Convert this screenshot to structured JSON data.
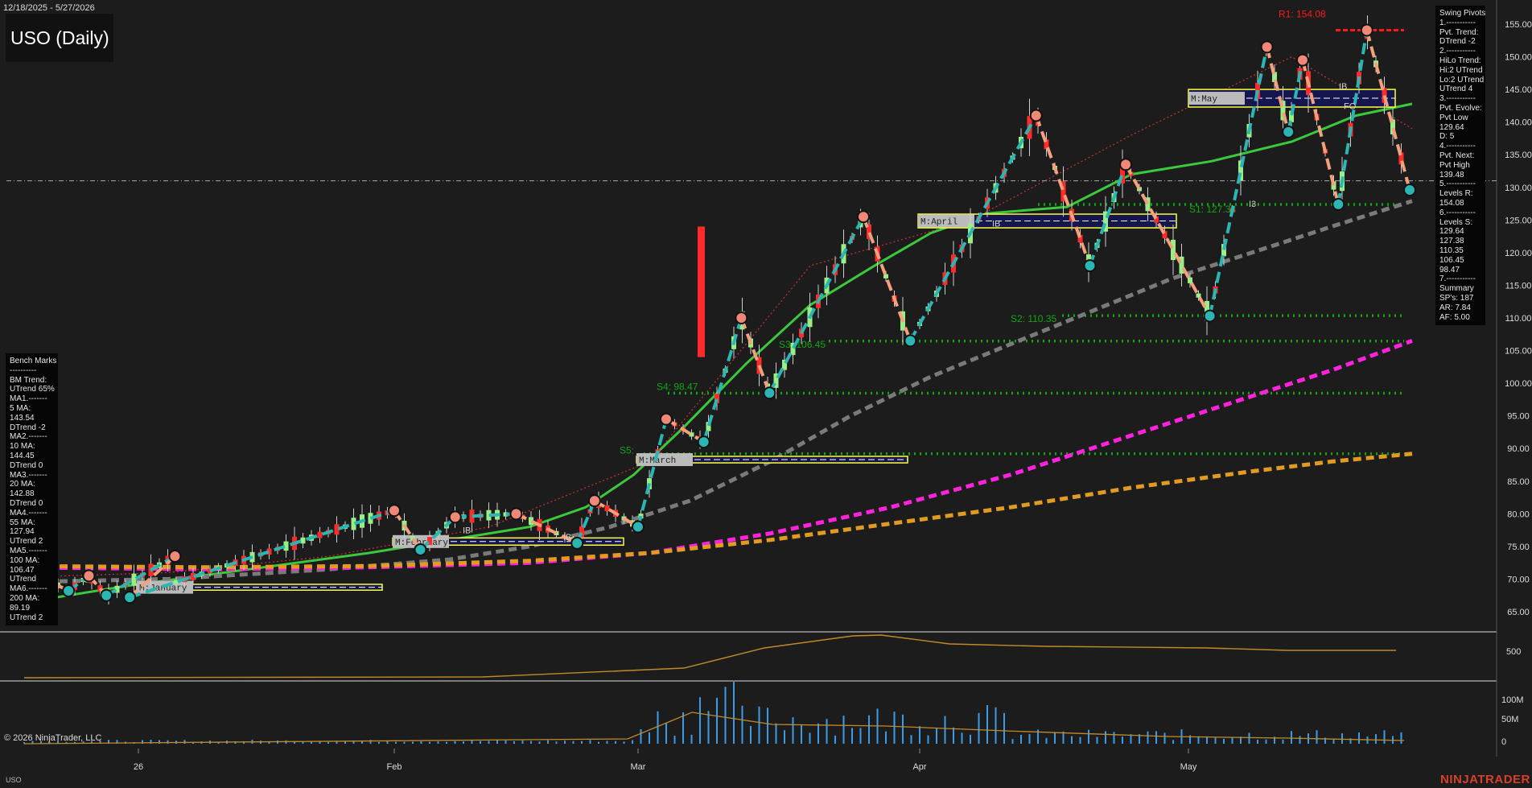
{
  "header": {
    "date_range": "12/18/2025 - 5/27/2026",
    "instrument_title": "USO (Daily)"
  },
  "footer": {
    "copyright": "© 2026 NinjaTrader, LLC",
    "symbol": "USO",
    "brand": "NINJATRADER"
  },
  "swing_pivots": {
    "lines": [
      "Swing Pivots",
      "1.-----------",
      "Pvt. Trend:",
      "DTrend -2",
      "2.-----------",
      "HiLo Trend:",
      "Hi:2 UTrend",
      "Lo:2 UTrend",
      "UTrend 4",
      "3.-----------",
      "Pvt. Evolve:",
      "Pvt Low",
      "129.64",
      "D: 5",
      "4.-----------",
      "Pvt. Next:",
      "Pvt High",
      "139.48",
      "5.-----------",
      "Levels R:",
      "154.08",
      "6.-----------",
      "Levels S:",
      "129.64",
      "127.38",
      "110.35",
      "106.45",
      "98.47",
      "7.-----------",
      "Summary",
      "SP's: 187",
      "AR: 7.84",
      "AF: 5.00"
    ]
  },
  "bench_marks": {
    "lines": [
      "Bench Marks",
      "----------",
      "BM Trend:",
      "UTrend 65%",
      "MA1.-------",
      "5 MA:",
      "143.54",
      "DTrend -2",
      "MA2.-------",
      "10 MA:",
      "144.45",
      "DTrend 0",
      "MA3.-------",
      "20 MA:",
      "142.88",
      "DTrend 0",
      "MA4.-------",
      "55 MA:",
      "127.94",
      "UTrend 2",
      "MA5.-------",
      "100 MA:",
      "106.47",
      "UTrend",
      "MA6.-------",
      "200 MA:",
      "89.19",
      "UTrend 2"
    ]
  },
  "chart_data": {
    "type": "candlestick",
    "price_axis": {
      "min": 62,
      "max": 157,
      "ticks": [
        65,
        70,
        75,
        80,
        85,
        90,
        95,
        100,
        105,
        110,
        115,
        120,
        125,
        130,
        135,
        140,
        145,
        150,
        155
      ],
      "tick_format": "0.00"
    },
    "x_tick_labels": [
      {
        "label": "26",
        "date": "2026-01-26"
      },
      {
        "label": "Feb",
        "date": "2026-02-02"
      },
      {
        "label": "Mar",
        "date": "2026-03-02"
      },
      {
        "label": "Apr",
        "date": "2026-04-01"
      },
      {
        "label": "May",
        "date": "2026-05-01"
      }
    ],
    "reference_price": 131.0,
    "resistance_levels": [
      {
        "label": "R1: 154.08",
        "value": 154.08
      }
    ],
    "support_levels": [
      {
        "label": "S1: 127.38",
        "value": 127.38
      },
      {
        "label": "S2: 110.35",
        "value": 110.35
      },
      {
        "label": "S3: 106.45",
        "value": 106.45
      },
      {
        "label": "S4: 98.47",
        "value": 98.47
      },
      {
        "label": "S5:",
        "value": 89.2
      }
    ],
    "month_labels": [
      {
        "label": "M:January",
        "low": 68.3,
        "high": 69.2
      },
      {
        "label": "M:February",
        "low": 75.2,
        "high": 76.3
      },
      {
        "label": "M:March",
        "low": 87.8,
        "high": 88.8
      },
      {
        "label": "M:April",
        "low": 123.8,
        "high": 125.9
      },
      {
        "label": "M:May",
        "low": 142.3,
        "high": 145.0
      }
    ],
    "pivot_markers": [
      "IB",
      "IB",
      "IB",
      "IB",
      "FO",
      "I3"
    ],
    "swing_points": [
      {
        "date": "2025-12-23",
        "price": 70.5,
        "type": "high"
      },
      {
        "date": "2026-01-02",
        "price": 68.2,
        "type": "low"
      },
      {
        "date": "2026-01-09",
        "price": 70.5,
        "type": "high"
      },
      {
        "date": "2026-01-15",
        "price": 67.5,
        "type": "low"
      },
      {
        "date": "2026-01-27",
        "price": 73.5,
        "type": "high"
      },
      {
        "date": "2026-01-23",
        "price": 67.2,
        "type": "low"
      },
      {
        "date": "2026-02-02",
        "price": 80.5,
        "type": "high"
      },
      {
        "date": "2026-02-05",
        "price": 74.5,
        "type": "low"
      },
      {
        "date": "2026-02-09",
        "price": 79.5,
        "type": "high"
      },
      {
        "date": "2026-02-16",
        "price": 80.0,
        "type": "high"
      },
      {
        "date": "2026-02-23",
        "price": 75.5,
        "type": "low"
      },
      {
        "date": "2026-02-25",
        "price": 82.0,
        "type": "high"
      },
      {
        "date": "2026-03-02",
        "price": 78.0,
        "type": "low"
      },
      {
        "date": "2026-03-05",
        "price": 94.5,
        "type": "high"
      },
      {
        "date": "2026-03-09",
        "price": 91.0,
        "type": "low"
      },
      {
        "date": "2026-03-13",
        "price": 110.0,
        "type": "high"
      },
      {
        "date": "2026-03-16",
        "price": 98.5,
        "type": "low"
      },
      {
        "date": "2026-03-26",
        "price": 125.5,
        "type": "high"
      },
      {
        "date": "2026-03-31",
        "price": 106.5,
        "type": "low"
      },
      {
        "date": "2026-04-14",
        "price": 141.0,
        "type": "high"
      },
      {
        "date": "2026-04-20",
        "price": 118.0,
        "type": "low"
      },
      {
        "date": "2026-04-24",
        "price": 133.5,
        "type": "high"
      },
      {
        "date": "2026-05-04",
        "price": 110.3,
        "type": "low"
      },
      {
        "date": "2026-05-12",
        "price": 151.5,
        "type": "high"
      },
      {
        "date": "2026-05-15",
        "price": 138.5,
        "type": "low"
      },
      {
        "date": "2026-05-17",
        "price": 149.5,
        "type": "high"
      },
      {
        "date": "2026-05-22",
        "price": 127.4,
        "type": "low"
      },
      {
        "date": "2026-05-26",
        "price": 154.08,
        "type": "high"
      },
      {
        "date": "2026-06-01",
        "price": 129.6,
        "type": "low"
      }
    ],
    "moving_averages": [
      {
        "name": "5 MA",
        "color": "#cc3333",
        "style": "dotted",
        "points": [
          [
            0,
            70.2
          ],
          [
            20,
            71.0
          ],
          [
            40,
            73.5
          ],
          [
            60,
            78.0
          ],
          [
            80,
            88
          ],
          [
            100,
            118
          ],
          [
            120,
            125
          ],
          [
            140,
            138
          ],
          [
            160,
            150
          ],
          [
            175,
            139
          ]
        ]
      },
      {
        "name": "20 MA",
        "color": "#3cc83c",
        "style": "solid",
        "points": [
          [
            0,
            66
          ],
          [
            15,
            69
          ],
          [
            30,
            71.5
          ],
          [
            45,
            74
          ],
          [
            55,
            76
          ],
          [
            65,
            78
          ],
          [
            72,
            81
          ],
          [
            78,
            86
          ],
          [
            84,
            93
          ],
          [
            92,
            103
          ],
          [
            100,
            112
          ],
          [
            108,
            118
          ],
          [
            115,
            123
          ],
          [
            122,
            126
          ],
          [
            132,
            127
          ],
          [
            140,
            132
          ],
          [
            150,
            134
          ],
          [
            160,
            137
          ],
          [
            168,
            141
          ],
          [
            175,
            142.8
          ]
        ]
      },
      {
        "name": "55 MA",
        "color": "#7a7a7a",
        "style": "dashed",
        "points": [
          [
            0,
            69.5
          ],
          [
            20,
            70
          ],
          [
            40,
            71.5
          ],
          [
            55,
            73
          ],
          [
            65,
            75
          ],
          [
            75,
            78
          ],
          [
            85,
            82
          ],
          [
            95,
            88
          ],
          [
            105,
            95
          ],
          [
            115,
            101
          ],
          [
            125,
            106
          ],
          [
            135,
            111
          ],
          [
            145,
            116
          ],
          [
            155,
            120
          ],
          [
            165,
            124
          ],
          [
            175,
            127.9
          ]
        ]
      },
      {
        "name": "100 MA",
        "color": "#ff22dd",
        "style": "dashed",
        "points": [
          [
            0,
            71.8
          ],
          [
            25,
            71.5
          ],
          [
            45,
            71.8
          ],
          [
            65,
            72.5
          ],
          [
            80,
            74
          ],
          [
            95,
            77
          ],
          [
            110,
            81
          ],
          [
            125,
            86
          ],
          [
            140,
            92
          ],
          [
            155,
            98
          ],
          [
            165,
            102
          ],
          [
            175,
            106.5
          ]
        ]
      },
      {
        "name": "200 MA",
        "color": "#e09b20",
        "style": "dashed",
        "points": [
          [
            0,
            72.0
          ],
          [
            25,
            71.8
          ],
          [
            45,
            72.0
          ],
          [
            65,
            72.8
          ],
          [
            80,
            74
          ],
          [
            95,
            76
          ],
          [
            110,
            78.5
          ],
          [
            125,
            81
          ],
          [
            140,
            84
          ],
          [
            155,
            86.5
          ],
          [
            165,
            88
          ],
          [
            175,
            89.2
          ]
        ]
      }
    ],
    "volume_axis": {
      "ticks": [
        "100M",
        "50M",
        "0"
      ]
    },
    "indicator_axis": {
      "ticks": [
        "500"
      ]
    }
  },
  "colors": {
    "bull_candle": "#9aee86",
    "bear_candle": "#ff2a2a",
    "swing_up": "#2bb5b3",
    "swing_down": "#f3a07d",
    "support": "#11a611",
    "resistance": "#ff1a1a"
  }
}
